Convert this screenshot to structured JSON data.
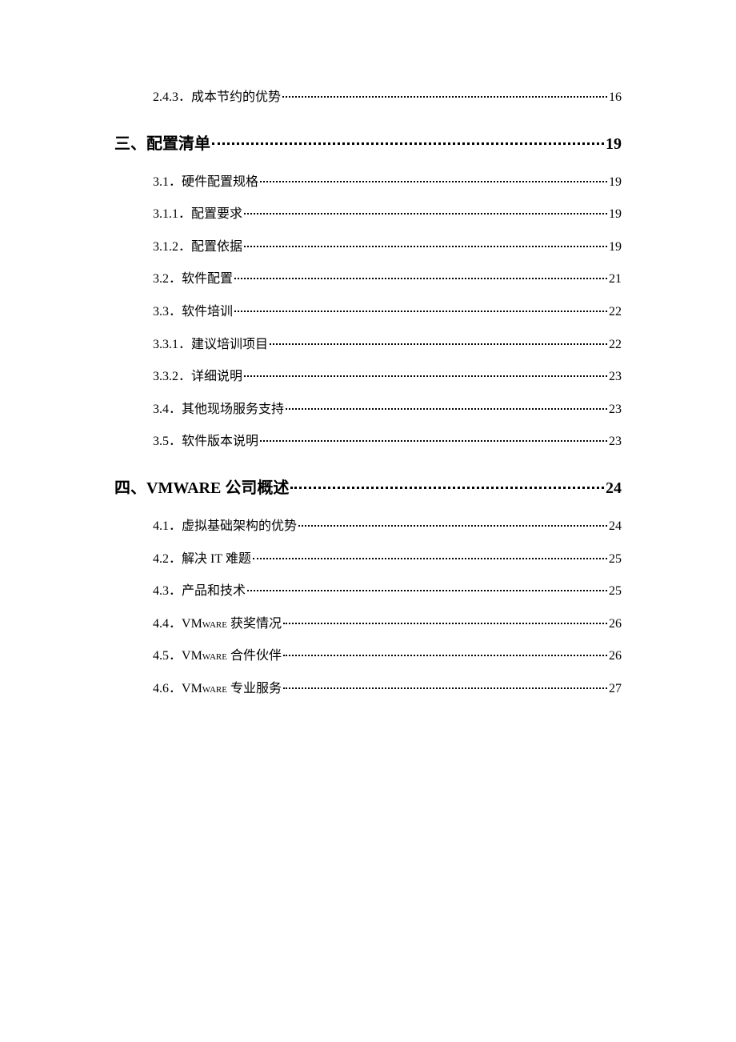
{
  "toc": {
    "leading": {
      "number": "2.4.3．",
      "title": "成本节约的优势",
      "page": "16"
    },
    "chapters": [
      {
        "heading_number": "三、",
        "heading_title": "配置清单",
        "heading_page": "19",
        "items": [
          {
            "number": "3.1．",
            "title": "硬件配置规格",
            "page": "19"
          },
          {
            "number": "3.1.1．",
            "title": "配置要求",
            "page": "19"
          },
          {
            "number": "3.1.2．",
            "title": "配置依据",
            "page": "19"
          },
          {
            "number": "3.2．",
            "title": "软件配置",
            "page": "21"
          },
          {
            "number": "3.3．",
            "title": "软件培训",
            "page": "22"
          },
          {
            "number": "3.3.1．",
            "title": "建议培训项目",
            "page": "22"
          },
          {
            "number": "3.3.2．",
            "title": "详细说明",
            "page": "23"
          },
          {
            "number": "3.4．",
            "title": "其他现场服务支持",
            "page": "23"
          },
          {
            "number": "3.5．",
            "title": "软件版本说明",
            "page": "23"
          }
        ]
      },
      {
        "heading_number": "四、",
        "heading_title": "VMWARE 公司概述",
        "heading_page": "24",
        "items": [
          {
            "number": "4.1．",
            "title": "虚拟基础架构的优势",
            "page": "24"
          },
          {
            "number": "4.2．",
            "title": "解决 IT 难题",
            "page": "25"
          },
          {
            "number": "4.3．",
            "title": "产品和技术",
            "page": "25"
          },
          {
            "number": "4.4．",
            "title_prefix": "VM",
            "title_smallcaps": "ware",
            "title_suffix": " 获奖情况",
            "page": "26"
          },
          {
            "number": "4.5．",
            "title_prefix": "VM",
            "title_smallcaps": "ware",
            "title_suffix": " 合件伙伴",
            "page": "26"
          },
          {
            "number": "4.6．",
            "title_prefix": "VM",
            "title_smallcaps": "ware",
            "title_suffix": " 专业服务",
            "page": "27"
          }
        ]
      }
    ]
  }
}
